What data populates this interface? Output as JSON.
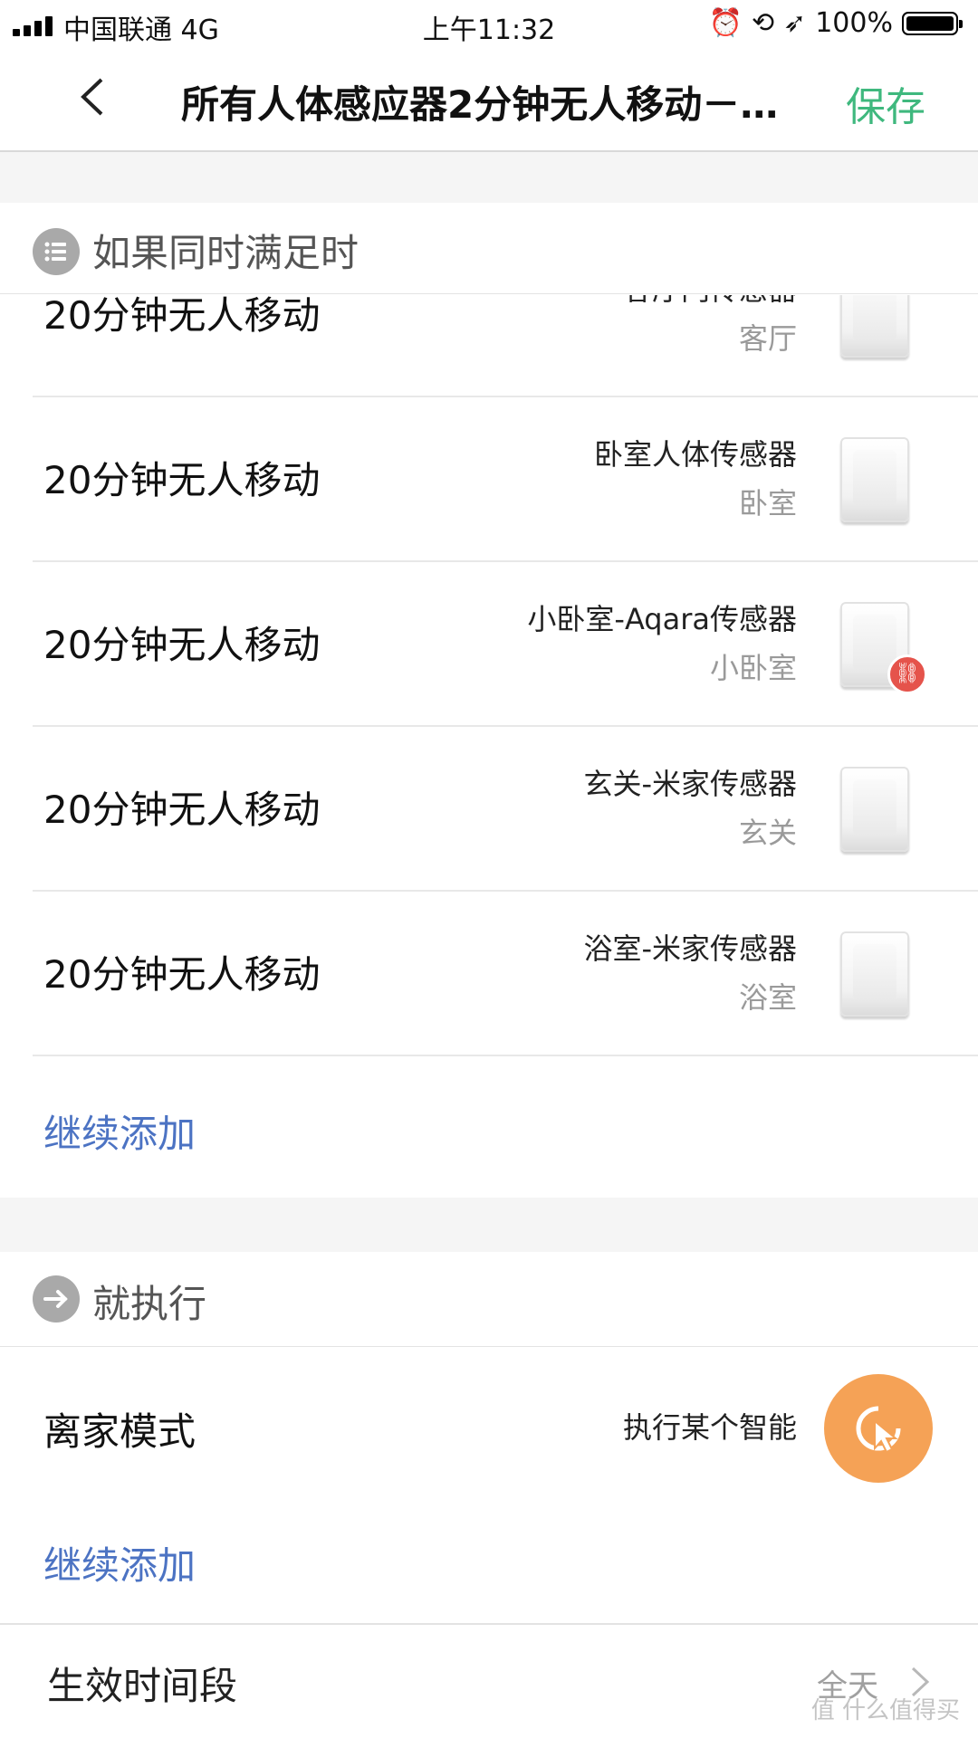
{
  "status_bar": {
    "carrier": "中国联通 4G",
    "time": "上午11:32",
    "battery": "100%"
  },
  "nav": {
    "title": "所有人体感应器2分钟无人移动－…",
    "save": "保存"
  },
  "if_section": {
    "header": "如果同时满足时",
    "conditions": [
      {
        "condition": "20分钟无人移动",
        "device": "客厅门传感器",
        "room": "客厅"
      },
      {
        "condition": "20分钟无人移动",
        "device": "卧室人体传感器",
        "room": "卧室"
      },
      {
        "condition": "20分钟无人移动",
        "device": "小卧室-Aqara传感器",
        "room": "小卧室"
      },
      {
        "condition": "20分钟无人移动",
        "device": "玄关-米家传感器",
        "room": "玄关"
      },
      {
        "condition": "20分钟无人移动",
        "device": "浴室-米家传感器",
        "room": "浴室"
      }
    ],
    "add": "继续添加"
  },
  "then_section": {
    "header": "就执行",
    "action": {
      "name": "离家模式",
      "detail": "执行某个智能"
    },
    "add": "继续添加"
  },
  "footer": {
    "label": "生效时间段",
    "value": "全天"
  },
  "watermark": "值 什么值得买",
  "colors": {
    "save": "#3fb87e",
    "link": "#4c73c3",
    "action": "#f5a256",
    "badge": "#e5534b"
  },
  "icons": [
    "back-icon",
    "list-icon",
    "sensor-icon",
    "unlink-icon",
    "arrow-right-icon",
    "cursor-icon",
    "chevron-right-icon"
  ]
}
